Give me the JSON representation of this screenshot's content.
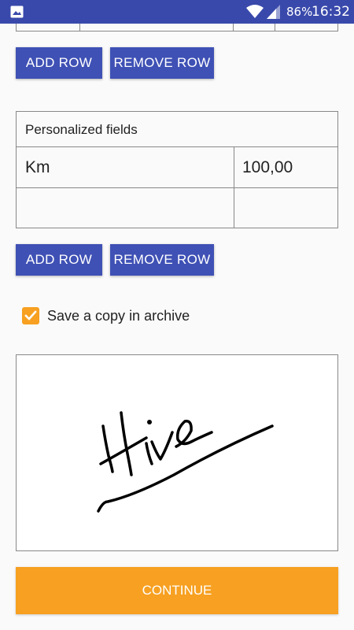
{
  "status_bar": {
    "battery": "86%",
    "time": "16:32",
    "icons": [
      "gallery-icon",
      "wifi-icon",
      "signal-icon"
    ]
  },
  "buttons_top": {
    "add_row": "ADD ROW",
    "remove_row": "REMOVE ROW"
  },
  "personalized": {
    "title": "Personalized fields",
    "rows": [
      {
        "name": "Km",
        "value": "100,00"
      },
      {
        "name": "",
        "value": ""
      }
    ]
  },
  "buttons_bottom": {
    "add_row": "ADD ROW",
    "remove_row": "REMOVE ROW"
  },
  "archive": {
    "checked": true,
    "label": "Save a copy in archive"
  },
  "continue_label": "CONTINUE",
  "colors": {
    "primary": "#3f51b5",
    "status_bar": "#3949ab",
    "accent": "#f7a021"
  }
}
